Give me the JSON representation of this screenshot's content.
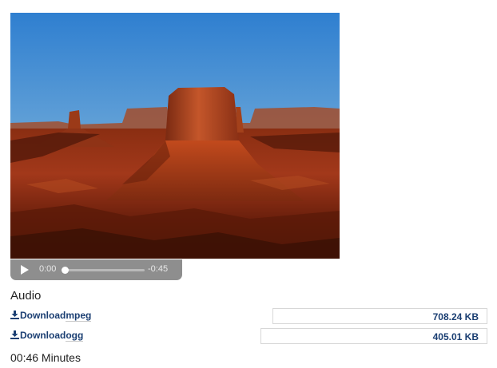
{
  "media": {
    "image_icon": "desert-butte-photo",
    "player": {
      "elapsed": "0:00",
      "remaining": "-0:45",
      "progress": 0,
      "play_icon": "play-icon"
    }
  },
  "audio": {
    "section_label": "Audio",
    "downloads": [
      {
        "link_prefix": "Download",
        "format": "mpeg",
        "size": "708.24 KB",
        "icon": "download-icon"
      },
      {
        "link_prefix": "Download",
        "format": "ogg",
        "size": "405.01 KB",
        "icon": "download-icon"
      }
    ],
    "duration": "00:46 Minutes"
  },
  "colors": {
    "link": "#1a3e72",
    "player_bg": "#8e8e8e",
    "sky": "#3f86c8",
    "rock": "#b0431c"
  }
}
